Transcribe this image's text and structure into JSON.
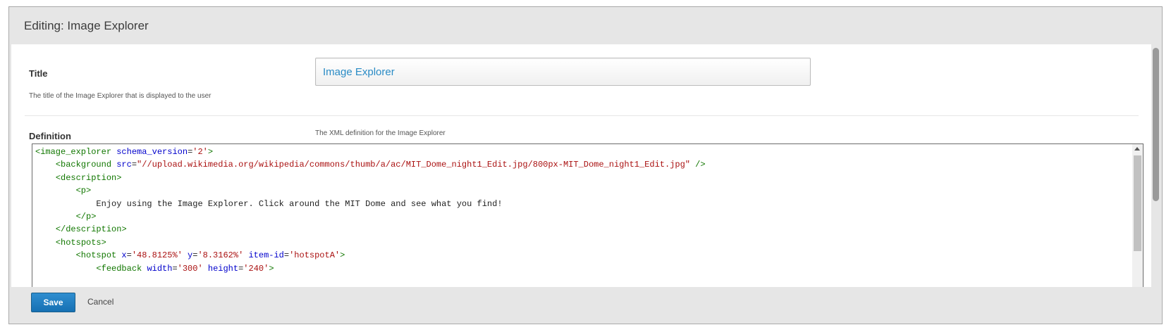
{
  "modal": {
    "title": "Editing: Image Explorer"
  },
  "fields": {
    "title": {
      "label": "Title",
      "value": "Image Explorer",
      "help": "The title of the Image Explorer that is displayed to the user"
    },
    "definition": {
      "label": "Definition",
      "help": "The XML definition for the Image Explorer",
      "lines": [
        "<image_explorer schema_version='2'>",
        "    <background src=\"//upload.wikimedia.org/wikipedia/commons/thumb/a/ac/MIT_Dome_night1_Edit.jpg/800px-MIT_Dome_night1_Edit.jpg\" />",
        "    <description>",
        "        <p>",
        "            Enjoy using the Image Explorer. Click around the MIT Dome and see what you find!",
        "        </p>",
        "    </description>",
        "    <hotspots>",
        "        <hotspot x='48.8125%' y='8.3162%' item-id='hotspotA'>",
        "            <feedback width='300' height='240'>"
      ]
    }
  },
  "footer": {
    "save_label": "Save",
    "cancel_label": "Cancel"
  },
  "colors": {
    "accent": "#1670b3",
    "input_text": "#2a8bc5",
    "tag": "#117700",
    "attribute": "#0000cc",
    "string": "#aa1111"
  }
}
